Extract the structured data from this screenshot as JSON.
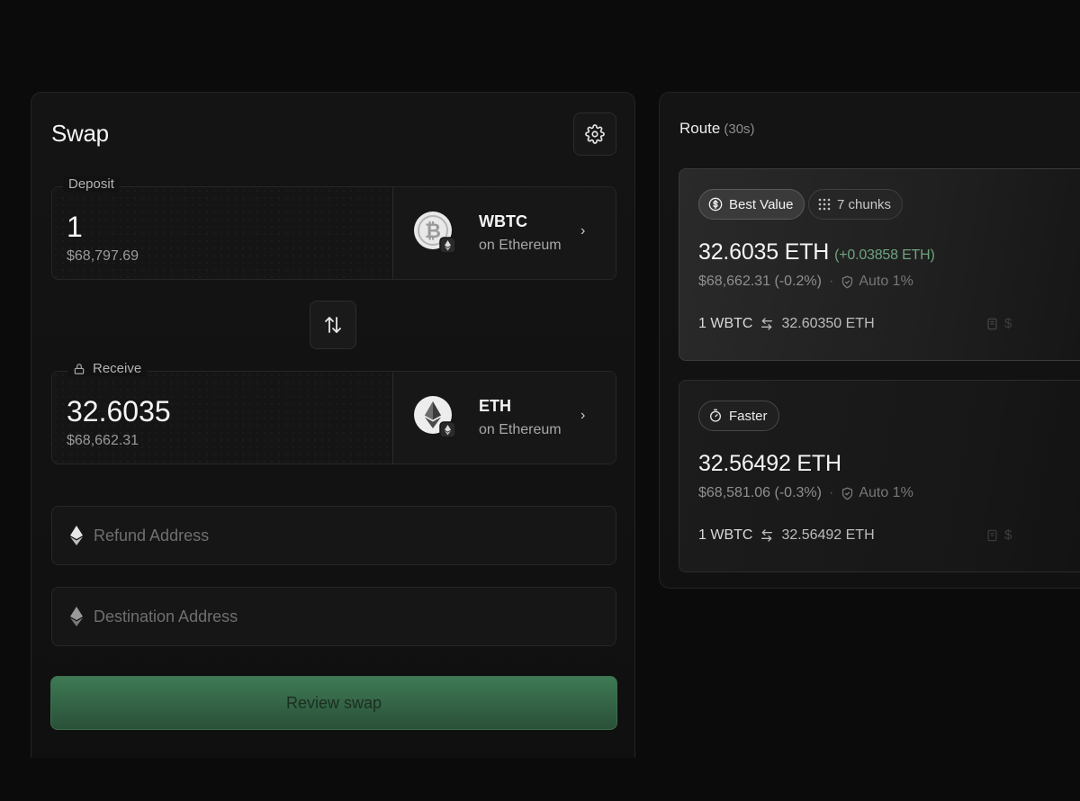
{
  "swap": {
    "title": "Swap",
    "deposit": {
      "label": "Deposit",
      "amount": "1",
      "usd": "$68,797.69",
      "token_symbol": "WBTC",
      "token_chain": "on Ethereum",
      "token_icon": "wbtc-icon"
    },
    "receive": {
      "label": "Receive",
      "amount": "32.6035",
      "usd": "$68,662.31",
      "token_symbol": "ETH",
      "token_chain": "on Ethereum",
      "token_icon": "eth-icon"
    },
    "refund_address": {
      "placeholder": "Refund Address",
      "value": ""
    },
    "destination_address": {
      "placeholder": "Destination Address",
      "value": ""
    },
    "review_label": "Review swap"
  },
  "route": {
    "title": "Route",
    "timer": "(30s)",
    "options": [
      {
        "badge": "Best Value",
        "chunks": "7 chunks",
        "amount": "32.6035 ETH",
        "delta": "(+0.03858 ETH)",
        "usd": "$68,662.31 (-0.2%)",
        "slippage": "Auto 1%",
        "rate_from": "1 WBTC",
        "rate_to": "32.60350 ETH",
        "extra": "$"
      },
      {
        "badge": "Faster",
        "amount": "32.56492 ETH",
        "usd": "$68,581.06 (-0.3%)",
        "slippage": "Auto 1%",
        "rate_from": "1 WBTC",
        "rate_to": "32.56492 ETH",
        "extra": "$"
      }
    ]
  },
  "colors": {
    "background": "#0b0b0b",
    "accent_green": "#3e7a54",
    "delta_green": "#6fa37f"
  }
}
